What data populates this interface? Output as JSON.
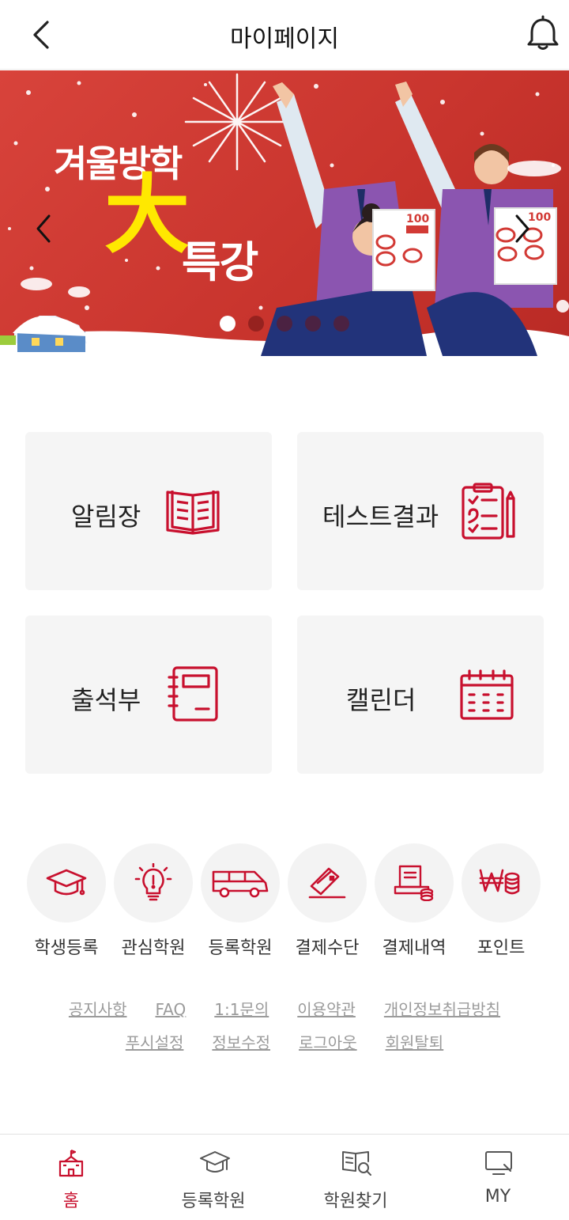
{
  "header": {
    "title": "마이페이지",
    "back_icon": "chevron-left-icon",
    "bell_icon": "bell-icon"
  },
  "banner": {
    "line1": "겨울방학",
    "line2": "大",
    "line3": "특강",
    "slide_count": 5,
    "active_slide": 1,
    "sheet_score": "100"
  },
  "cards": [
    {
      "label": "알림장",
      "icon": "open-book-icon"
    },
    {
      "label": "테스트결과",
      "icon": "checklist-icon"
    },
    {
      "label": "출석부",
      "icon": "notebook-icon"
    },
    {
      "label": "캘린더",
      "icon": "calendar-icon"
    }
  ],
  "quick_menu": [
    {
      "label": "학생등록",
      "icon": "graduation-cap-icon"
    },
    {
      "label": "관심학원",
      "icon": "lightbulb-icon"
    },
    {
      "label": "등록학원",
      "icon": "bus-icon"
    },
    {
      "label": "결제수단",
      "icon": "card-icon"
    },
    {
      "label": "결제내역",
      "icon": "receipt-icon"
    },
    {
      "label": "포인트",
      "icon": "won-coins-icon"
    }
  ],
  "links_row1": [
    "공지사항",
    "FAQ",
    "1:1문의",
    "이용약관",
    "개인정보취급방침"
  ],
  "links_row2": [
    "푸시설정",
    "정보수정",
    "로그아웃",
    "회원탈퇴"
  ],
  "bottom_nav": [
    {
      "label": "홈",
      "icon": "school-building-icon",
      "active": true
    },
    {
      "label": "등록학원",
      "icon": "graduation-cap-icon",
      "active": false
    },
    {
      "label": "학원찾기",
      "icon": "book-search-icon",
      "active": false
    },
    {
      "label": "MY",
      "icon": "monitor-icon",
      "active": false
    }
  ],
  "colors": {
    "accent": "#c8102e",
    "banner_red": "#d13b33",
    "highlight_yellow": "#ffe800"
  }
}
